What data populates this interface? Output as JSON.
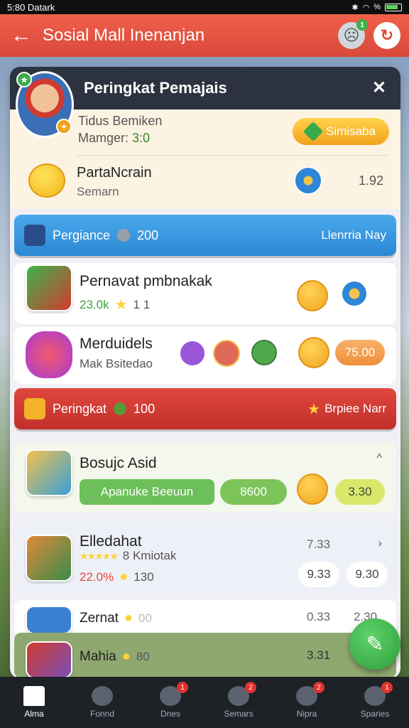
{
  "status_bar": {
    "time": "5:80 Datark",
    "battery": "%"
  },
  "app_bar": {
    "title": "Sosial Mall Inenanjan",
    "notif_count": "1"
  },
  "panel": {
    "title": "Peringkat Pemajais",
    "user": {
      "line1": "Tidus Bemiken",
      "line2_label": "Mamger:",
      "line2_value": "3:0",
      "button": "Simisaba"
    },
    "info": {
      "title": "PartaNcrain",
      "sub": "Semarn",
      "value": "1.92"
    }
  },
  "banner_blue": {
    "label": "Pergiance",
    "value": "200",
    "right": "Llenrria Nay"
  },
  "row1": {
    "title": "Pernavat pmbnakak",
    "stat1": "23.0k",
    "stat2": "1 1"
  },
  "row2": {
    "title": "Merduidels",
    "sub": "Mak Bsitedao",
    "pill": "75.00"
  },
  "banner_red": {
    "label": "Peringkat",
    "value": "100",
    "right": "Brpiee Narr"
  },
  "row3": {
    "title": "Bosujc Asid",
    "green_pill": "Apanuke Beeuun",
    "pill1": "8600",
    "pill2": "3.30"
  },
  "row4": {
    "title": "Elledahat",
    "rating": "8 Kmiotak",
    "stat1": "22.0%",
    "stat2": "130",
    "value_top": "7.33",
    "pill1": "9.33",
    "pill2": "9.30"
  },
  "row5": {
    "title": "Zernat",
    "stat": "00",
    "v1": "0.33",
    "v2": "2.30"
  },
  "row6": {
    "title": "Mahia",
    "stat": "80",
    "v1": "3.31"
  },
  "bottom_nav": [
    {
      "label": "Alma",
      "badge": ""
    },
    {
      "label": "Fonnd",
      "badge": ""
    },
    {
      "label": "Dnes",
      "badge": "1"
    },
    {
      "label": "Semars",
      "badge": "2"
    },
    {
      "label": "Nipra",
      "badge": "2"
    },
    {
      "label": "Sparies",
      "badge": "1"
    }
  ]
}
